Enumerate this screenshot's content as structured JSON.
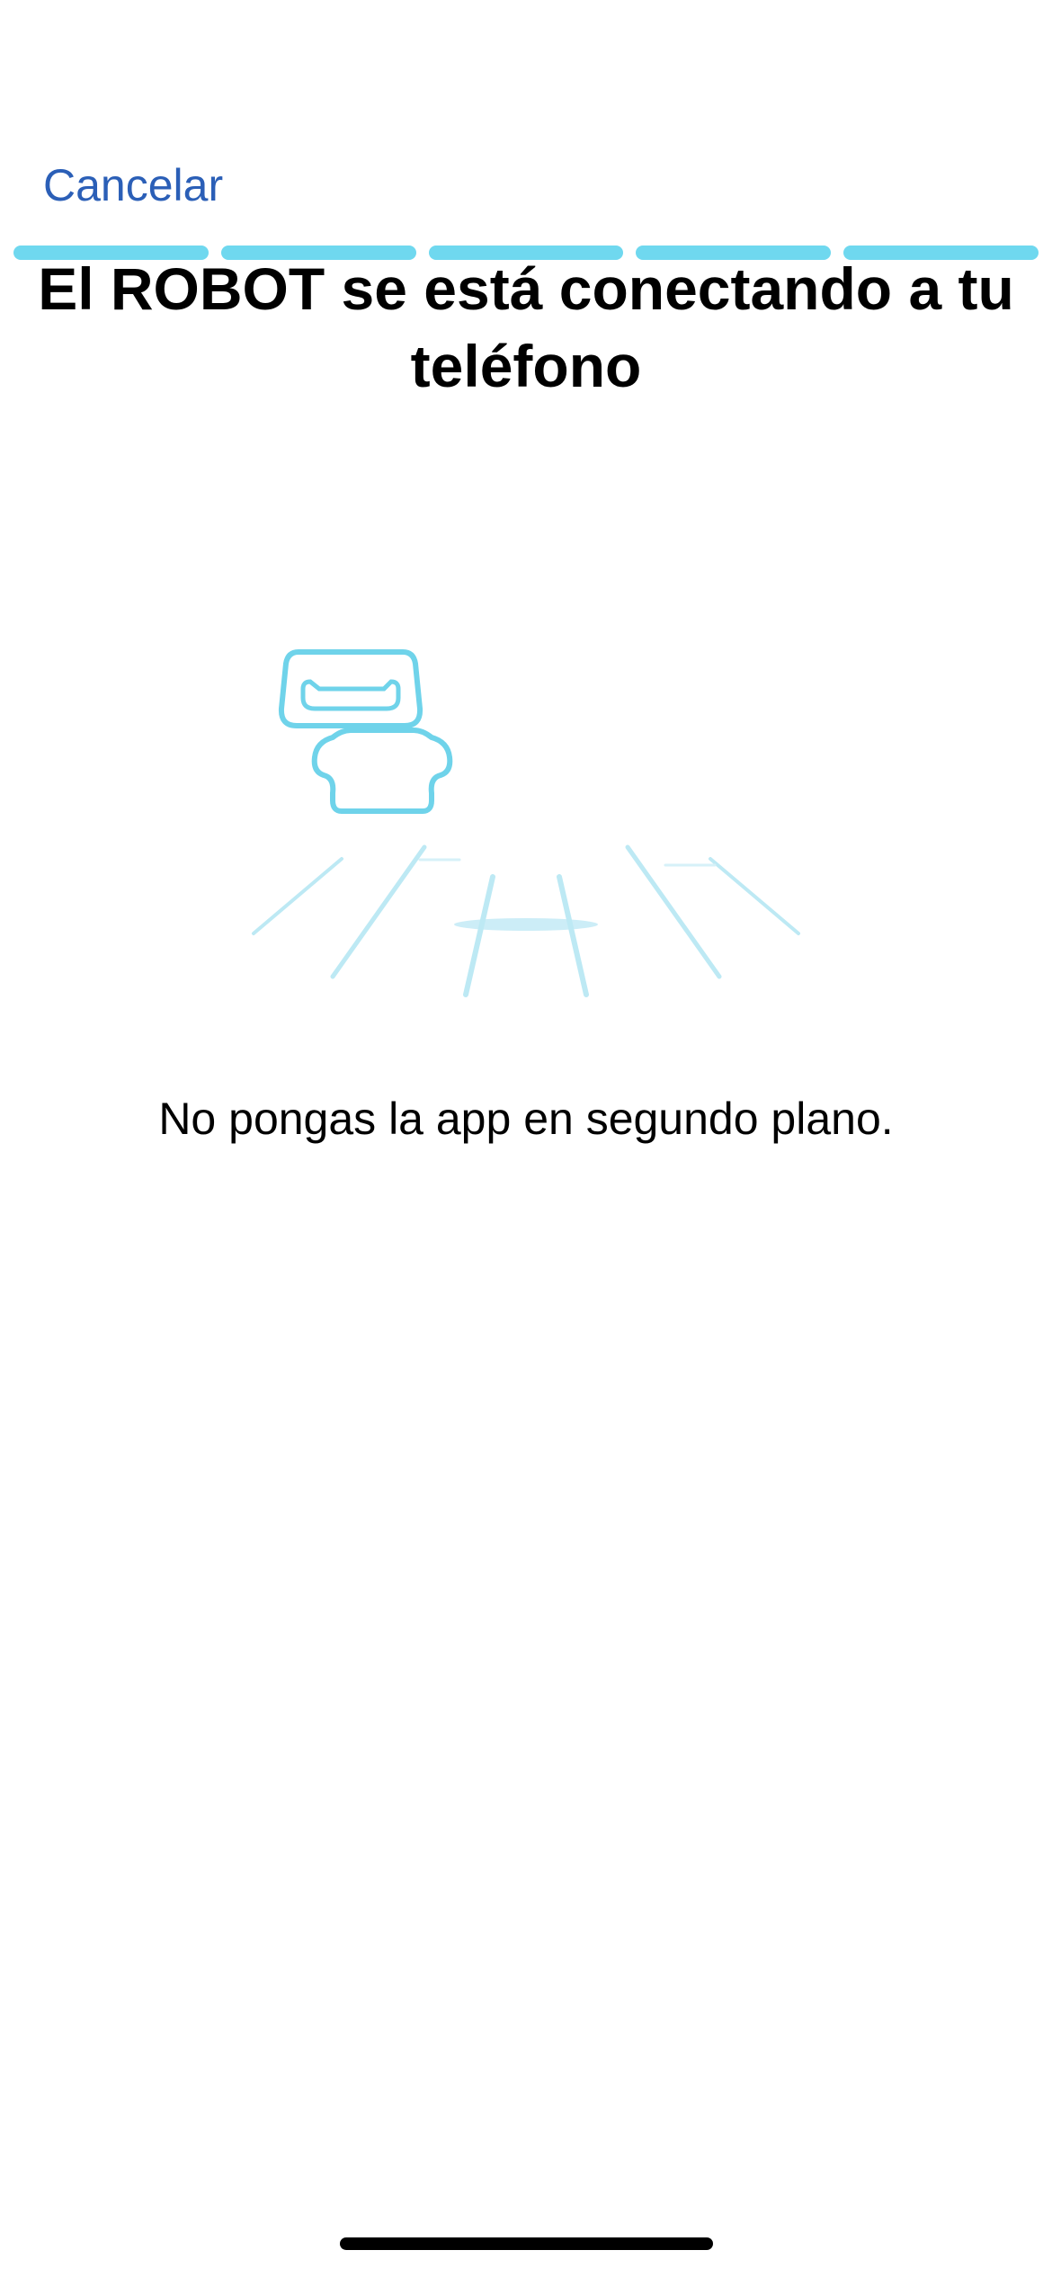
{
  "header": {
    "cancel_label": "Cancelar"
  },
  "progress": {
    "total_steps": 5,
    "completed_steps": 5,
    "segments": [
      "step-1",
      "step-2",
      "step-3",
      "step-4",
      "step-5"
    ]
  },
  "main": {
    "title": "El ROBOT se está conectando a tu teléfono",
    "illustration_icon": "robot-connecting-icon",
    "hint": "No pongas la app en segundo plano."
  },
  "colors": {
    "accent": "#6fd8ef",
    "link": "#2b5fb7",
    "illustration": "#6fd3ea",
    "illustration_faint": "#bde9f4"
  }
}
